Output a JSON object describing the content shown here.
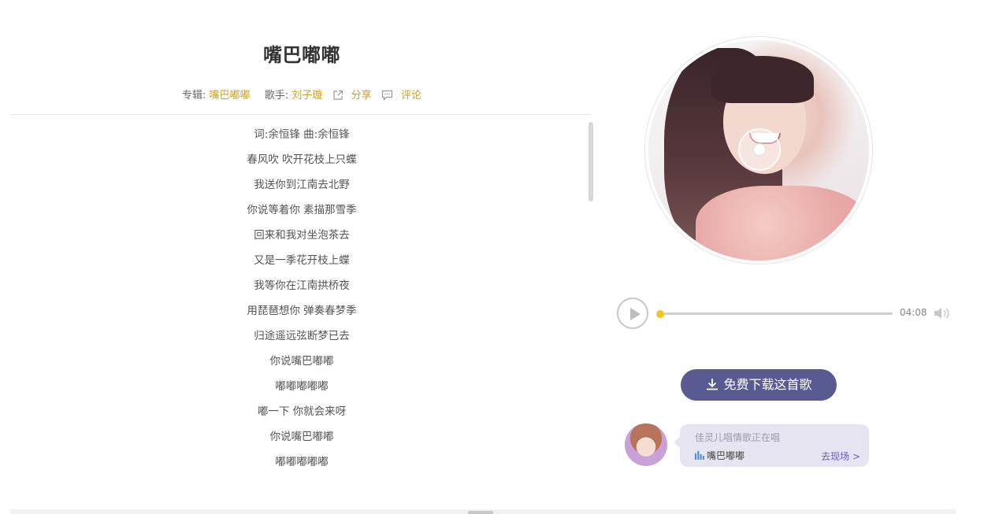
{
  "song": {
    "title": "嘴巴嘟嘟",
    "album_label": "专辑:",
    "album": "嘴巴嘟嘟",
    "singer_label": "歌手:",
    "singer": "刘子璇",
    "share_label": "分享",
    "comment_label": "评论"
  },
  "lyrics": [
    "词:余恒锋 曲:余恒锋",
    "春风吹 吹开花枝上只蝶",
    "我送你到江南去北野",
    "你说等着你 素描那雪季",
    "回来和我对坐泡茶去",
    "又是一季花开枝上蝶",
    "我等你在江南拱桥夜",
    "用琵琶想你 弹奏春梦季",
    "归途遥远弦断梦已去",
    "你说嘴巴嘟嘟",
    "嘟嘟嘟嘟嘟",
    "嘟一下 你就会来呀",
    "你说嘴巴嘟嘟",
    "嘟嘟嘟嘟嘟"
  ],
  "player": {
    "duration": "04:08",
    "progress": 0
  },
  "download_button": "免费下载这首歌",
  "live": {
    "status": "佳灵儿唱情歌正在唱",
    "song": "嘴巴嘟嘟",
    "link": "去现场 >"
  },
  "colors": {
    "accent_gold": "#c9a227",
    "knob_yellow": "#f5c518",
    "download_bg": "#5a5a93",
    "bubble_bg": "#e5e4f0",
    "link_purple": "#6a5acd"
  },
  "icons": {
    "share": "share-icon",
    "comment": "comment-icon",
    "play": "play-icon",
    "volume": "volume-icon",
    "download": "download-icon",
    "equalizer": "equalizer-icon"
  }
}
